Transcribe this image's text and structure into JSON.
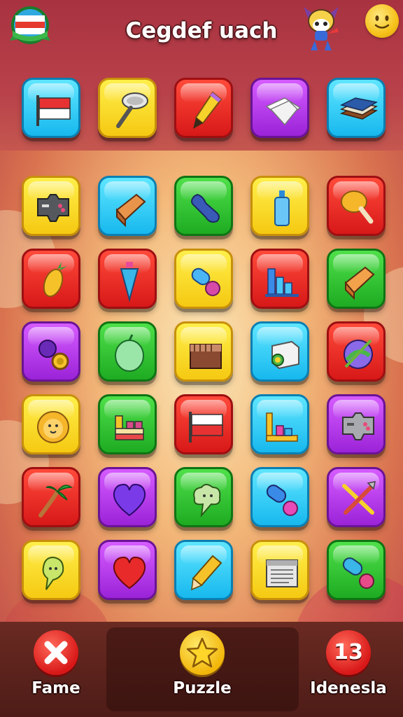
{
  "header": {
    "title": "Cegdef uach",
    "badge_icon": "flag-badge-icon",
    "mascot_icon": "mascot-icon",
    "mood_icon": "smiley-icon"
  },
  "colors": {
    "red": "#e02a22",
    "yellow": "#f9d92a",
    "cyan": "#2fcaf6",
    "green": "#2bbd2c",
    "purple": "#b03ae6"
  },
  "top_row": [
    {
      "color": "cyan",
      "icon": "flag-icon"
    },
    {
      "color": "yellow",
      "icon": "funnel-icon"
    },
    {
      "color": "red",
      "icon": "paintbrush-icon"
    },
    {
      "color": "purple",
      "icon": "paper-icon"
    },
    {
      "color": "cyan",
      "icon": "books-icon"
    }
  ],
  "grid": [
    [
      {
        "color": "yellow",
        "icon": "gamepad-icon"
      },
      {
        "color": "cyan",
        "icon": "eraser-icon"
      },
      {
        "color": "green",
        "icon": "wrench-icon"
      },
      {
        "color": "yellow",
        "icon": "bottle-icon"
      },
      {
        "color": "red",
        "icon": "drumstick-icon"
      }
    ],
    [
      {
        "color": "red",
        "icon": "pineapple-icon"
      },
      {
        "color": "red",
        "icon": "crystal-icon"
      },
      {
        "color": "yellow",
        "icon": "pacifier-icon"
      },
      {
        "color": "red",
        "icon": "bar-chart-icon"
      },
      {
        "color": "green",
        "icon": "eraser-icon"
      }
    ],
    [
      {
        "color": "purple",
        "icon": "berry-ring-icon"
      },
      {
        "color": "green",
        "icon": "melon-icon"
      },
      {
        "color": "yellow",
        "icon": "crate-icon"
      },
      {
        "color": "cyan",
        "icon": "box-icon"
      },
      {
        "color": "red",
        "icon": "globe-pencil-icon"
      }
    ],
    [
      {
        "color": "yellow",
        "icon": "lion-icon"
      },
      {
        "color": "green",
        "icon": "blocks-icon"
      },
      {
        "color": "red",
        "icon": "flag-icon"
      },
      {
        "color": "cyan",
        "icon": "bar-chart-icon"
      },
      {
        "color": "purple",
        "icon": "gamepad-icon"
      }
    ],
    [
      {
        "color": "red",
        "icon": "palm-tree-icon"
      },
      {
        "color": "purple",
        "icon": "heart-icon"
      },
      {
        "color": "green",
        "icon": "cloud-creature-icon"
      },
      {
        "color": "cyan",
        "icon": "pacifier-icon"
      },
      {
        "color": "purple",
        "icon": "crossed-tools-icon"
      }
    ],
    [
      {
        "color": "yellow",
        "icon": "ghost-icon"
      },
      {
        "color": "purple",
        "icon": "heart-icon"
      },
      {
        "color": "cyan",
        "icon": "pencil-icon"
      },
      {
        "color": "yellow",
        "icon": "document-icon"
      },
      {
        "color": "green",
        "icon": "pacifier-icon"
      }
    ]
  ],
  "bottom_nav": {
    "left": {
      "label": "Fame",
      "icon": "close-icon"
    },
    "center": {
      "label": "Puzzle",
      "icon": "star-icon"
    },
    "right": {
      "label": "Idenesla",
      "icon": "count-badge-icon",
      "badge": "13"
    }
  }
}
